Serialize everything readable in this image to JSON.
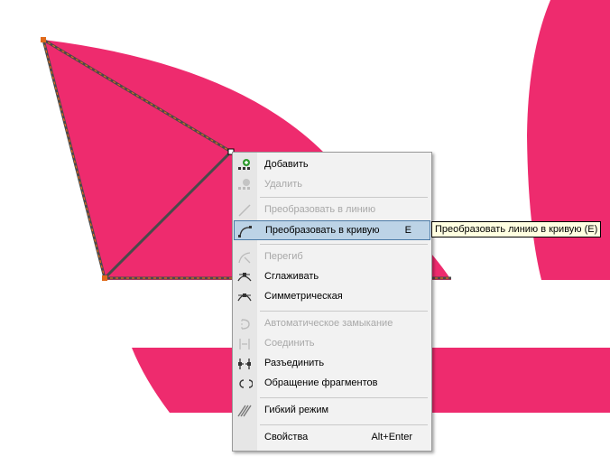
{
  "colors": {
    "shape_fill": "#ee2b6e",
    "outline": "#4a4a4a",
    "node": "#e06a1a"
  },
  "menu": {
    "items": [
      {
        "label": "Добавить",
        "icon": "add-node-icon",
        "enabled": true
      },
      {
        "label": "Удалить",
        "icon": "delete-node-icon",
        "enabled": false
      },
      {
        "label": "Преобразовать в линию",
        "icon": "to-line-icon",
        "enabled": false
      },
      {
        "label": "Преобразовать в кривую",
        "shortcut": "E",
        "icon": "to-curve-icon",
        "enabled": true,
        "selected": true
      },
      {
        "label": "Перегиб",
        "icon": "cusp-icon",
        "enabled": false
      },
      {
        "label": "Сглаживать",
        "icon": "smooth-icon",
        "enabled": true
      },
      {
        "label": "Симметрическая",
        "icon": "symmetric-icon",
        "enabled": true
      },
      {
        "label": "Автоматическое замыкание",
        "icon": "auto-close-icon",
        "enabled": false
      },
      {
        "label": "Соединить",
        "icon": "join-icon",
        "enabled": false
      },
      {
        "label": "Разъединить",
        "icon": "break-apart-icon",
        "enabled": true
      },
      {
        "label": "Обращение фрагментов",
        "icon": "reverse-icon",
        "enabled": true
      },
      {
        "label": "Гибкий режим",
        "icon": "elastic-mode-icon",
        "enabled": true
      },
      {
        "label": "Свойства",
        "shortcut": "Alt+Enter",
        "icon": "",
        "enabled": true
      }
    ]
  },
  "tooltip": {
    "text": "Преобразовать линию в кривую (E)"
  }
}
